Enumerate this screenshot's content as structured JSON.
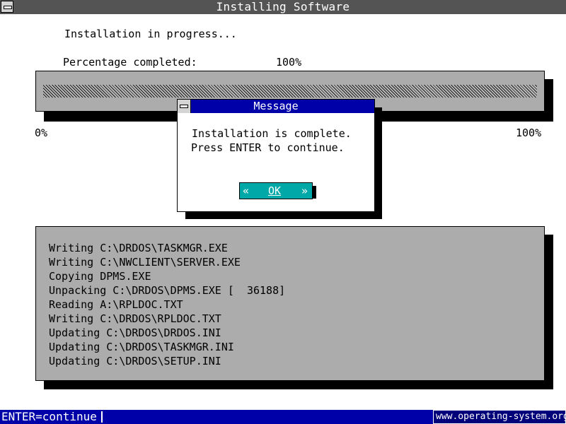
{
  "window": {
    "title": "Installing Software"
  },
  "main": {
    "status_line": "Installation in progress...",
    "percentage_label": "Percentage completed:",
    "percentage_value": "100%",
    "progress": 1.0,
    "scale_min": "0%",
    "scale_max": "100%"
  },
  "dialog": {
    "title": "Message",
    "line1": "Installation is complete.",
    "line2": "Press ENTER to continue.",
    "ok_left": "«",
    "ok_label": "OK",
    "ok_right": "»"
  },
  "log": {
    "lines": [
      "Writing C:\\DRDOS\\TASKMGR.EXE",
      "Writing C:\\NWCLIENT\\SERVER.EXE",
      "Copying DPMS.EXE",
      "Unpacking C:\\DRDOS\\DPMS.EXE [  36188]",
      "Reading A:\\RPLDOC.TXT",
      "Writing C:\\DRDOS\\RPLDOC.TXT",
      "Updating C:\\DRDOS\\DRDOS.INI",
      "Updating C:\\DRDOS\\TASKMGR.INI",
      "Updating C:\\DRDOS\\SETUP.INI"
    ]
  },
  "statusbar": {
    "text": "ENTER=continue"
  },
  "watermark": {
    "text": "www.operating-system.org"
  },
  "colors": {
    "titlebar": "#545454",
    "dialog_title": "#0000a8",
    "button": "#00a8a8",
    "panel": "#acacac",
    "statusbar": "#0000a8"
  }
}
